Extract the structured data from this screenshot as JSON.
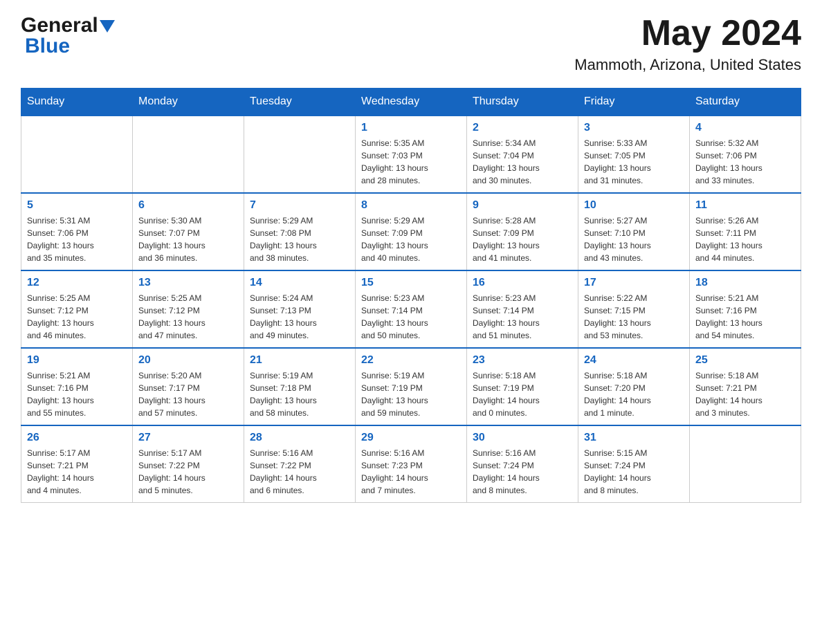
{
  "header": {
    "logo_general": "General",
    "logo_blue": "Blue",
    "month_title": "May 2024",
    "location": "Mammoth, Arizona, United States"
  },
  "calendar": {
    "days_of_week": [
      "Sunday",
      "Monday",
      "Tuesday",
      "Wednesday",
      "Thursday",
      "Friday",
      "Saturday"
    ],
    "weeks": [
      [
        {
          "day": "",
          "info": ""
        },
        {
          "day": "",
          "info": ""
        },
        {
          "day": "",
          "info": ""
        },
        {
          "day": "1",
          "info": "Sunrise: 5:35 AM\nSunset: 7:03 PM\nDaylight: 13 hours\nand 28 minutes."
        },
        {
          "day": "2",
          "info": "Sunrise: 5:34 AM\nSunset: 7:04 PM\nDaylight: 13 hours\nand 30 minutes."
        },
        {
          "day": "3",
          "info": "Sunrise: 5:33 AM\nSunset: 7:05 PM\nDaylight: 13 hours\nand 31 minutes."
        },
        {
          "day": "4",
          "info": "Sunrise: 5:32 AM\nSunset: 7:06 PM\nDaylight: 13 hours\nand 33 minutes."
        }
      ],
      [
        {
          "day": "5",
          "info": "Sunrise: 5:31 AM\nSunset: 7:06 PM\nDaylight: 13 hours\nand 35 minutes."
        },
        {
          "day": "6",
          "info": "Sunrise: 5:30 AM\nSunset: 7:07 PM\nDaylight: 13 hours\nand 36 minutes."
        },
        {
          "day": "7",
          "info": "Sunrise: 5:29 AM\nSunset: 7:08 PM\nDaylight: 13 hours\nand 38 minutes."
        },
        {
          "day": "8",
          "info": "Sunrise: 5:29 AM\nSunset: 7:09 PM\nDaylight: 13 hours\nand 40 minutes."
        },
        {
          "day": "9",
          "info": "Sunrise: 5:28 AM\nSunset: 7:09 PM\nDaylight: 13 hours\nand 41 minutes."
        },
        {
          "day": "10",
          "info": "Sunrise: 5:27 AM\nSunset: 7:10 PM\nDaylight: 13 hours\nand 43 minutes."
        },
        {
          "day": "11",
          "info": "Sunrise: 5:26 AM\nSunset: 7:11 PM\nDaylight: 13 hours\nand 44 minutes."
        }
      ],
      [
        {
          "day": "12",
          "info": "Sunrise: 5:25 AM\nSunset: 7:12 PM\nDaylight: 13 hours\nand 46 minutes."
        },
        {
          "day": "13",
          "info": "Sunrise: 5:25 AM\nSunset: 7:12 PM\nDaylight: 13 hours\nand 47 minutes."
        },
        {
          "day": "14",
          "info": "Sunrise: 5:24 AM\nSunset: 7:13 PM\nDaylight: 13 hours\nand 49 minutes."
        },
        {
          "day": "15",
          "info": "Sunrise: 5:23 AM\nSunset: 7:14 PM\nDaylight: 13 hours\nand 50 minutes."
        },
        {
          "day": "16",
          "info": "Sunrise: 5:23 AM\nSunset: 7:14 PM\nDaylight: 13 hours\nand 51 minutes."
        },
        {
          "day": "17",
          "info": "Sunrise: 5:22 AM\nSunset: 7:15 PM\nDaylight: 13 hours\nand 53 minutes."
        },
        {
          "day": "18",
          "info": "Sunrise: 5:21 AM\nSunset: 7:16 PM\nDaylight: 13 hours\nand 54 minutes."
        }
      ],
      [
        {
          "day": "19",
          "info": "Sunrise: 5:21 AM\nSunset: 7:16 PM\nDaylight: 13 hours\nand 55 minutes."
        },
        {
          "day": "20",
          "info": "Sunrise: 5:20 AM\nSunset: 7:17 PM\nDaylight: 13 hours\nand 57 minutes."
        },
        {
          "day": "21",
          "info": "Sunrise: 5:19 AM\nSunset: 7:18 PM\nDaylight: 13 hours\nand 58 minutes."
        },
        {
          "day": "22",
          "info": "Sunrise: 5:19 AM\nSunset: 7:19 PM\nDaylight: 13 hours\nand 59 minutes."
        },
        {
          "day": "23",
          "info": "Sunrise: 5:18 AM\nSunset: 7:19 PM\nDaylight: 14 hours\nand 0 minutes."
        },
        {
          "day": "24",
          "info": "Sunrise: 5:18 AM\nSunset: 7:20 PM\nDaylight: 14 hours\nand 1 minute."
        },
        {
          "day": "25",
          "info": "Sunrise: 5:18 AM\nSunset: 7:21 PM\nDaylight: 14 hours\nand 3 minutes."
        }
      ],
      [
        {
          "day": "26",
          "info": "Sunrise: 5:17 AM\nSunset: 7:21 PM\nDaylight: 14 hours\nand 4 minutes."
        },
        {
          "day": "27",
          "info": "Sunrise: 5:17 AM\nSunset: 7:22 PM\nDaylight: 14 hours\nand 5 minutes."
        },
        {
          "day": "28",
          "info": "Sunrise: 5:16 AM\nSunset: 7:22 PM\nDaylight: 14 hours\nand 6 minutes."
        },
        {
          "day": "29",
          "info": "Sunrise: 5:16 AM\nSunset: 7:23 PM\nDaylight: 14 hours\nand 7 minutes."
        },
        {
          "day": "30",
          "info": "Sunrise: 5:16 AM\nSunset: 7:24 PM\nDaylight: 14 hours\nand 8 minutes."
        },
        {
          "day": "31",
          "info": "Sunrise: 5:15 AM\nSunset: 7:24 PM\nDaylight: 14 hours\nand 8 minutes."
        },
        {
          "day": "",
          "info": ""
        }
      ]
    ]
  }
}
